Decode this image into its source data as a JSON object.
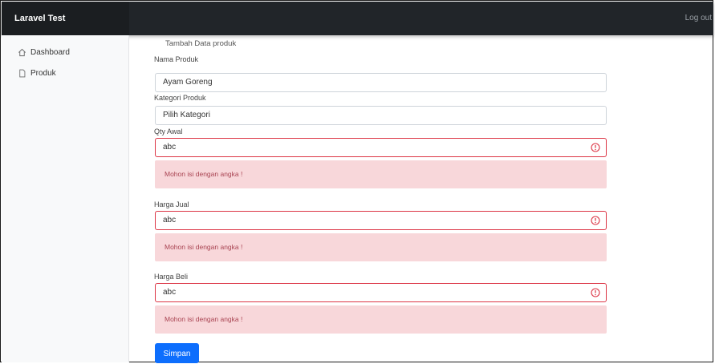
{
  "app": {
    "brand": "Laravel Test",
    "signout_label": "Log out"
  },
  "sidebar": {
    "items": [
      {
        "label": "Dashboard",
        "icon": "house-icon"
      },
      {
        "label": "Produk",
        "icon": "file-icon"
      }
    ]
  },
  "page": {
    "title": "Tambah Data produk"
  },
  "form": {
    "nama_produk": {
      "label": "Nama Produk",
      "value": "Ayam Goreng"
    },
    "kategori_produk": {
      "label": "Kategori Produk",
      "value": "Pilih Kategori"
    },
    "qty_awal": {
      "label": "Qty Awal",
      "value": "abc",
      "error": "Mohon isi dengan angka !"
    },
    "harga_jual": {
      "label": "Harga Jual",
      "value": "abc",
      "error": "Mohon isi dengan angka !"
    },
    "harga_beli": {
      "label": "Harga Beli",
      "value": "abc",
      "error": "Mohon isi dengan angka !"
    },
    "submit_label": "Simpan"
  },
  "colors": {
    "navbar": "#212529",
    "error": "#dc3545",
    "error_bg": "#f8d7da",
    "primary": "#0d6efd"
  }
}
